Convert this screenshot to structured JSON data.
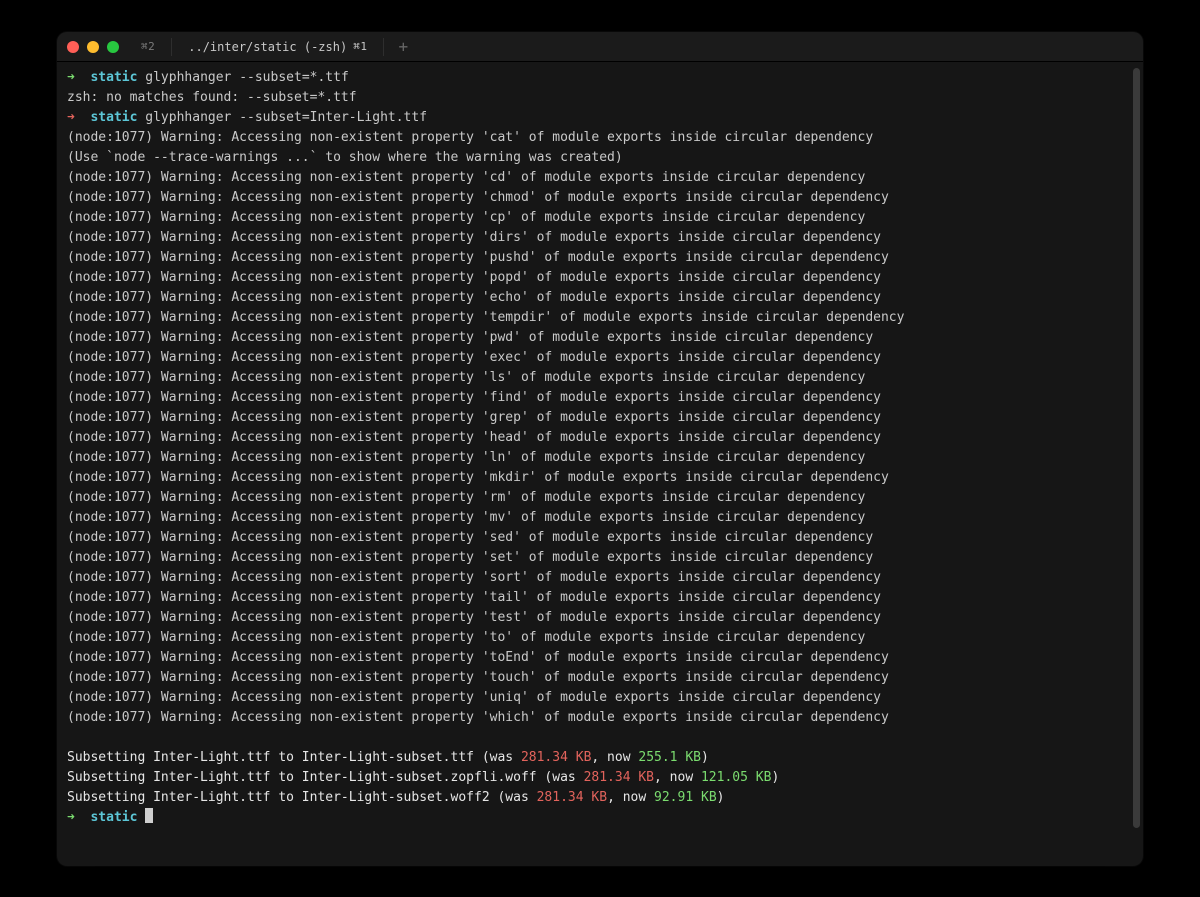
{
  "titlebar": {
    "cmd_hint": "⌘2",
    "tab_label": "../inter/static (-zsh)",
    "tab_kbd": "⌘1"
  },
  "prompts": {
    "arrow": "➜",
    "cwd": "static",
    "cmd1": "glyphhanger --subset=*.ttf",
    "err1": "zsh: no matches found: --subset=*.ttf",
    "cmd2": "glyphhanger --subset=Inter-Light.ttf"
  },
  "warnings": {
    "prefix": "(node:1077) Warning: Accessing non-existent property '",
    "suffix": "' of module exports inside circular dependency",
    "trace_hint": "(Use `node --trace-warnings ...` to show where the warning was created)",
    "props": [
      "cat",
      "cd",
      "chmod",
      "cp",
      "dirs",
      "pushd",
      "popd",
      "echo",
      "tempdir",
      "pwd",
      "exec",
      "ls",
      "find",
      "grep",
      "head",
      "ln",
      "mkdir",
      "rm",
      "mv",
      "sed",
      "set",
      "sort",
      "tail",
      "test",
      "to",
      "toEnd",
      "touch",
      "uniq",
      "which"
    ]
  },
  "subset": {
    "rows": [
      {
        "text_a": "Subsetting Inter-Light.ttf to Inter-Light-subset.ttf (was ",
        "was": "281.34 KB",
        "text_b": ", now ",
        "now": "255.1 KB",
        "text_c": ")"
      },
      {
        "text_a": "Subsetting Inter-Light.ttf to Inter-Light-subset.zopfli.woff (was ",
        "was": "281.34 KB",
        "text_b": ", now ",
        "now": "121.05 KB",
        "text_c": ")"
      },
      {
        "text_a": "Subsetting Inter-Light.ttf to Inter-Light-subset.woff2 (was ",
        "was": "281.34 KB",
        "text_b": ", now ",
        "now": "92.91 KB",
        "text_c": ")"
      }
    ]
  }
}
